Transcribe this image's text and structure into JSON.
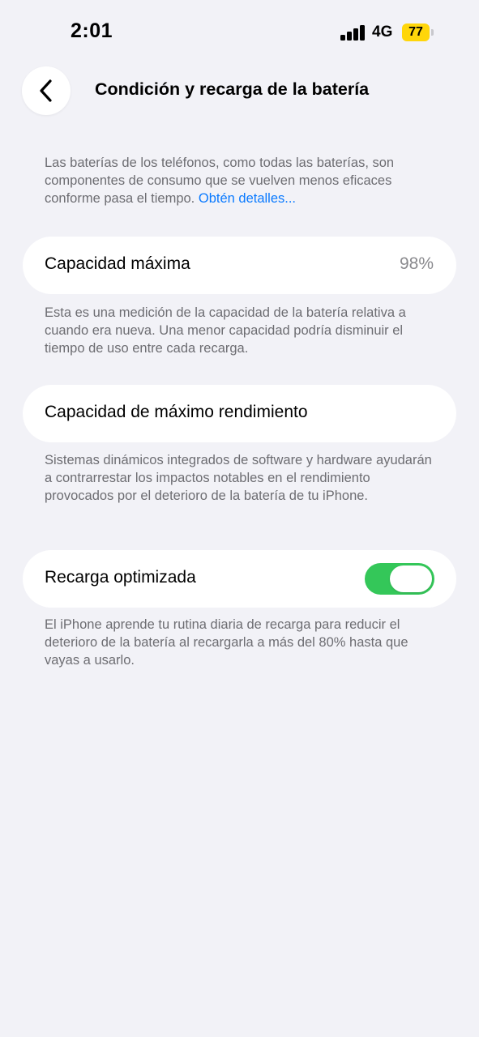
{
  "status_bar": {
    "time": "2:01",
    "network": "4G",
    "battery_level": "77"
  },
  "header": {
    "title": "Condición y recarga de la batería"
  },
  "intro": {
    "text": "Las baterías de los teléfonos, como todas las baterías, son componentes de consumo que se vuelven menos eficaces conforme pasa el tiempo. ",
    "link": "Obtén detalles..."
  },
  "max_capacity": {
    "label": "Capacidad máxima",
    "value": "98%",
    "footer": "Esta es una medición de la capacidad de la batería relativa a cuando era nueva. Una menor capacidad podría disminuir el tiempo de uso entre cada recarga."
  },
  "peak_performance": {
    "label": "Capacidad de máximo rendimiento",
    "footer": "Sistemas dinámicos integrados de software y hardware ayudarán a contrarrestar los impactos notables en el rendimiento provocados por el deterioro de la batería de tu iPhone."
  },
  "optimized_charging": {
    "label": "Recarga optimizada",
    "enabled": true,
    "footer": "El iPhone aprende tu rutina diaria de recarga para reducir el deterioro de la batería al recargarla a más del 80% hasta que vayas a usarlo."
  },
  "colors": {
    "toggle_on": "#34c759",
    "link": "#0a7aff",
    "battery": "#ffd60a"
  }
}
